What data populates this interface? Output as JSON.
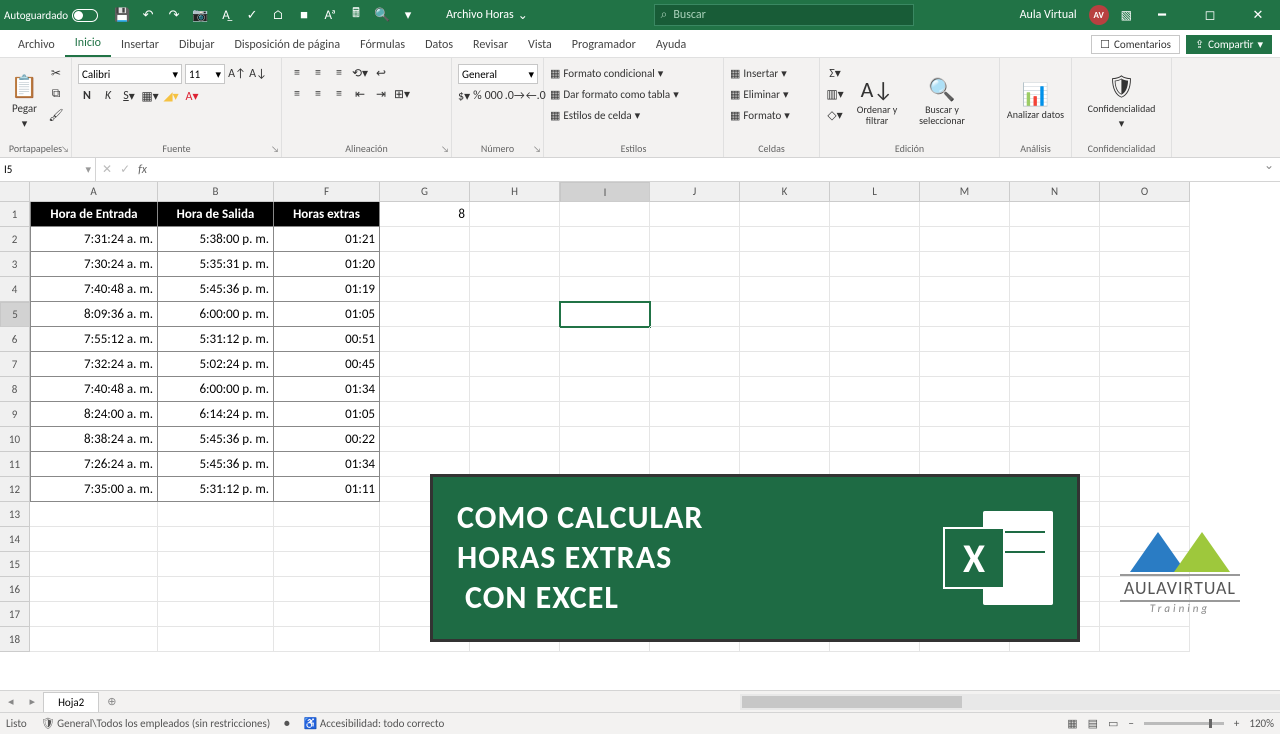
{
  "titlebar": {
    "autosave": "Autoguardado",
    "filename": "Archivo Horas",
    "search_placeholder": "Buscar",
    "user": "Aula Virtual",
    "avatar": "AV"
  },
  "tabs": [
    "Archivo",
    "Inicio",
    "Insertar",
    "Dibujar",
    "Disposición de página",
    "Fórmulas",
    "Datos",
    "Revisar",
    "Vista",
    "Programador",
    "Ayuda"
  ],
  "active_tab": "Inicio",
  "header_buttons": {
    "comments": "Comentarios",
    "share": "Compartir"
  },
  "ribbon": {
    "clipboard": {
      "paste": "Pegar",
      "label": "Portapapeles"
    },
    "font": {
      "name": "Calibri",
      "size": "11",
      "label": "Fuente"
    },
    "alignment": {
      "label": "Alineación"
    },
    "number": {
      "format": "General",
      "label": "Número"
    },
    "styles": {
      "cond": "Formato condicional",
      "table": "Dar formato como tabla",
      "cell": "Estilos de celda",
      "label": "Estilos"
    },
    "cells": {
      "insert": "Insertar",
      "delete": "Eliminar",
      "format": "Formato",
      "label": "Celdas"
    },
    "editing": {
      "sort": "Ordenar y filtrar",
      "find": "Buscar y seleccionar",
      "label": "Edición"
    },
    "analysis": {
      "analyze": "Analizar datos",
      "label": "Análisis"
    },
    "sensitivity": {
      "btn": "Confidencialidad",
      "label": "Confidencialidad"
    }
  },
  "namebox": "I5",
  "columns": [
    {
      "l": "A",
      "w": 128
    },
    {
      "l": "B",
      "w": 116
    },
    {
      "l": "F",
      "w": 106
    },
    {
      "l": "G",
      "w": 90
    },
    {
      "l": "H",
      "w": 90
    },
    {
      "l": "I",
      "w": 90
    },
    {
      "l": "J",
      "w": 90
    },
    {
      "l": "K",
      "w": 90
    },
    {
      "l": "L",
      "w": 90
    },
    {
      "l": "M",
      "w": 90
    },
    {
      "l": "N",
      "w": 90
    },
    {
      "l": "O",
      "w": 90
    }
  ],
  "headers": [
    "Hora de Entrada",
    "Hora de Salida",
    "Horas extras"
  ],
  "g1": "8",
  "rows": [
    [
      "7:31:24 a. m.",
      "5:38:00 p. m.",
      "01:21"
    ],
    [
      "7:30:24 a. m.",
      "5:35:31 p. m.",
      "01:20"
    ],
    [
      "7:40:48 a. m.",
      "5:45:36 p. m.",
      "01:19"
    ],
    [
      "8:09:36 a. m.",
      "6:00:00 p. m.",
      "01:05"
    ],
    [
      "7:55:12 a. m.",
      "5:31:12 p. m.",
      "00:51"
    ],
    [
      "7:32:24 a. m.",
      "5:02:24 p. m.",
      "00:45"
    ],
    [
      "7:40:48 a. m.",
      "6:00:00 p. m.",
      "01:34"
    ],
    [
      "8:24:00 a. m.",
      "6:14:24 p. m.",
      "01:05"
    ],
    [
      "8:38:24 a. m.",
      "5:45:36 p. m.",
      "00:22"
    ],
    [
      "7:26:24 a. m.",
      "5:45:36 p. m.",
      "01:34"
    ],
    [
      "7:35:00 a. m.",
      "5:31:12 p. m.",
      "01:11"
    ]
  ],
  "banner": {
    "l1": "COMO CALCULAR",
    "l2": "HORAS EXTRAS",
    "l3": "CON EXCEL"
  },
  "logo": {
    "name": "AULAVIRTUAL",
    "sub": "Training"
  },
  "sheet": "Hoja2",
  "status": {
    "ready": "Listo",
    "policy": "General\\Todos los empleados (sin restricciones)",
    "access": "Accesibilidad: todo correcto",
    "zoom": "120%"
  }
}
